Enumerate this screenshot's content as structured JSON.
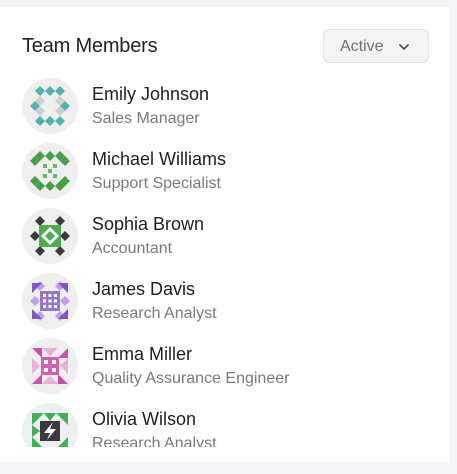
{
  "header": {
    "title": "Team Members",
    "filter_label": "Active",
    "filter_icon": "chevron-down-icon"
  },
  "members": [
    {
      "name": "Emily Johnson",
      "role": "Sales Manager",
      "avatar_icon": "identicon-avatar",
      "avatar_color": "#4db6ac"
    },
    {
      "name": "Michael Williams",
      "role": "Support Specialist",
      "avatar_icon": "identicon-avatar",
      "avatar_color": "#43a047"
    },
    {
      "name": "Sophia Brown",
      "role": "Accountant",
      "avatar_icon": "identicon-avatar",
      "avatar_color": "#4caf50"
    },
    {
      "name": "James Davis",
      "role": "Research Analyst",
      "avatar_icon": "identicon-avatar",
      "avatar_color": "#8e5bd6"
    },
    {
      "name": "Emma Miller",
      "role": "Quality Assurance Engineer",
      "avatar_icon": "identicon-avatar",
      "avatar_color": "#cc4fa6"
    },
    {
      "name": "Olivia Wilson",
      "role": "Research Analyst",
      "avatar_icon": "identicon-avatar",
      "avatar_color": "#3fb257"
    }
  ]
}
